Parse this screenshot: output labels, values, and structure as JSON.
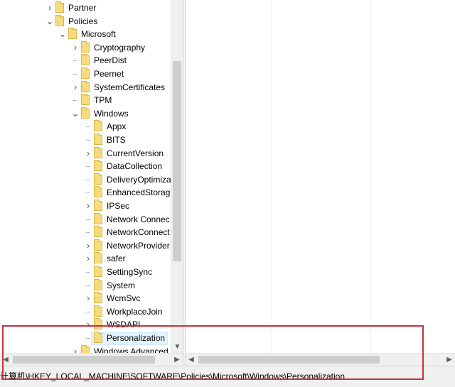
{
  "tree": {
    "items": [
      {
        "label": "Partner",
        "level": 0,
        "expander": "collapsed"
      },
      {
        "label": "Policies",
        "level": 0,
        "expander": "expanded"
      },
      {
        "label": "Microsoft",
        "level": 1,
        "expander": "expanded"
      },
      {
        "label": "Cryptography",
        "level": 2,
        "expander": "collapsed"
      },
      {
        "label": "PeerDist",
        "level": 2,
        "expander": "none"
      },
      {
        "label": "Peernet",
        "level": 2,
        "expander": "none"
      },
      {
        "label": "SystemCertificates",
        "level": 2,
        "expander": "collapsed"
      },
      {
        "label": "TPM",
        "level": 2,
        "expander": "none"
      },
      {
        "label": "Windows",
        "level": 2,
        "expander": "expanded"
      },
      {
        "label": "Appx",
        "level": 3,
        "expander": "none"
      },
      {
        "label": "BITS",
        "level": 3,
        "expander": "none"
      },
      {
        "label": "CurrentVersion",
        "level": 3,
        "expander": "collapsed"
      },
      {
        "label": "DataCollection",
        "level": 3,
        "expander": "none"
      },
      {
        "label": "DeliveryOptimiza",
        "level": 3,
        "expander": "none"
      },
      {
        "label": "EnhancedStorag",
        "level": 3,
        "expander": "none"
      },
      {
        "label": "IPSec",
        "level": 3,
        "expander": "collapsed"
      },
      {
        "label": "Network Connec",
        "level": 3,
        "expander": "none"
      },
      {
        "label": "NetworkConnect",
        "level": 3,
        "expander": "none"
      },
      {
        "label": "NetworkProvider",
        "level": 3,
        "expander": "collapsed"
      },
      {
        "label": "safer",
        "level": 3,
        "expander": "collapsed"
      },
      {
        "label": "SettingSync",
        "level": 3,
        "expander": "none"
      },
      {
        "label": "System",
        "level": 3,
        "expander": "none"
      },
      {
        "label": "WcmSvc",
        "level": 3,
        "expander": "collapsed"
      },
      {
        "label": "WorkplaceJoin",
        "level": 3,
        "expander": "none"
      },
      {
        "label": "WSDAPI",
        "level": 3,
        "expander": "collapsed"
      },
      {
        "label": "Personalization",
        "level": 3,
        "expander": "none",
        "selected": true
      },
      {
        "label": "Windows Advanced",
        "level": 2,
        "expander": "collapsed"
      }
    ]
  },
  "status_bar": {
    "path": "计算机\\HKEY_LOCAL_MACHINE\\SOFTWARE\\Policies\\Microsoft\\Windows\\Personalization"
  },
  "colors": {
    "folder": "#f6dc7c",
    "selection": "#e5f3ff",
    "annotation": "#c8323c"
  }
}
